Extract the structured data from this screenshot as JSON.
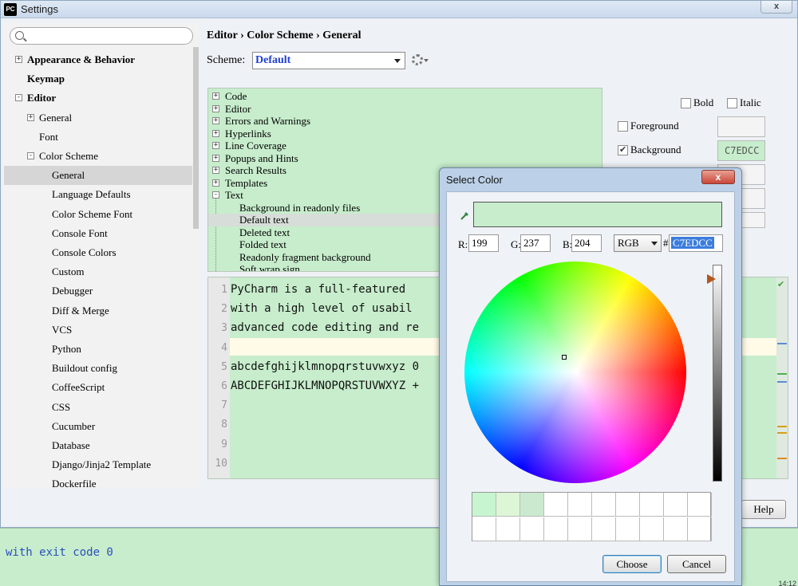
{
  "window": {
    "title": "Settings",
    "app_icon": "PC",
    "close_glyph": "x"
  },
  "search": {
    "placeholder": "",
    "value": ""
  },
  "sidebar": {
    "items": [
      {
        "label": "Appearance & Behavior",
        "toggle": "+"
      },
      {
        "label": "Keymap"
      },
      {
        "label": "Editor",
        "toggle": "-"
      },
      {
        "label": "General",
        "toggle": "+"
      },
      {
        "label": "Font"
      },
      {
        "label": "Color Scheme",
        "toggle": "-"
      },
      {
        "label": "General"
      },
      {
        "label": "Language Defaults"
      },
      {
        "label": "Color Scheme Font"
      },
      {
        "label": "Console Font"
      },
      {
        "label": "Console Colors"
      },
      {
        "label": "Custom"
      },
      {
        "label": "Debugger"
      },
      {
        "label": "Diff & Merge"
      },
      {
        "label": "VCS"
      },
      {
        "label": "Python"
      },
      {
        "label": "Buildout config"
      },
      {
        "label": "CoffeeScript"
      },
      {
        "label": "CSS"
      },
      {
        "label": "Cucumber"
      },
      {
        "label": "Database"
      },
      {
        "label": "Django/Jinja2 Template"
      },
      {
        "label": "Dockerfile"
      }
    ]
  },
  "breadcrumb": {
    "text": "Editor › Color Scheme › General"
  },
  "scheme": {
    "label": "Scheme:",
    "value": "Default"
  },
  "elements_tree": {
    "items": [
      {
        "label": "Code",
        "toggle": "+"
      },
      {
        "label": "Editor",
        "toggle": "+"
      },
      {
        "label": "Errors and Warnings",
        "toggle": "+"
      },
      {
        "label": "Hyperlinks",
        "toggle": "+"
      },
      {
        "label": "Line Coverage",
        "toggle": "+"
      },
      {
        "label": "Popups and Hints",
        "toggle": "+"
      },
      {
        "label": "Search Results",
        "toggle": "+"
      },
      {
        "label": "Templates",
        "toggle": "+"
      },
      {
        "label": "Text",
        "toggle": "-"
      },
      {
        "label": "Background in readonly files"
      },
      {
        "label": "Default text"
      },
      {
        "label": "Deleted text"
      },
      {
        "label": "Folded text"
      },
      {
        "label": "Readonly fragment background"
      },
      {
        "label": "Soft wrap sign"
      }
    ]
  },
  "attributes": {
    "bold_label": "Bold",
    "italic_label": "Italic",
    "foreground_label": "Foreground",
    "background_label": "Background",
    "background_value": "C7EDCC"
  },
  "preview": {
    "line_numbers": [
      "1",
      "2",
      "3",
      "4",
      "5",
      "6",
      "7",
      "8",
      "9",
      "10"
    ],
    "lines": [
      "PyCharm is a full-featured",
      "with a high level of usabil",
      "advanced code editing and re",
      "",
      "abcdefghijklmnopqrstuvwxyz 0",
      "ABCDEFGHIJKLMNOPQRSTUVWXYZ +"
    ]
  },
  "buttons": {
    "help": "Help"
  },
  "console": {
    "text": "with exit code 0",
    "time": "14:12"
  },
  "color_dialog": {
    "title": "Select Color",
    "close_glyph": "x",
    "r_label": "R:",
    "r_value": "199",
    "g_label": "G:",
    "g_value": "237",
    "b_label": "B:",
    "b_value": "204",
    "mode": "RGB",
    "hash": "#",
    "hex": "C7EDCC",
    "preview_color": "#c7edcc",
    "recent_colors": [
      "#c7f5cf",
      "#ddf6d6",
      "#cbe9cf"
    ],
    "choose_label": "Choose",
    "cancel_label": "Cancel"
  },
  "colors": {
    "scheme_background": "#c7edcc",
    "console_text": "#2b4fbf",
    "scheme_value": "#1f3fd0"
  }
}
